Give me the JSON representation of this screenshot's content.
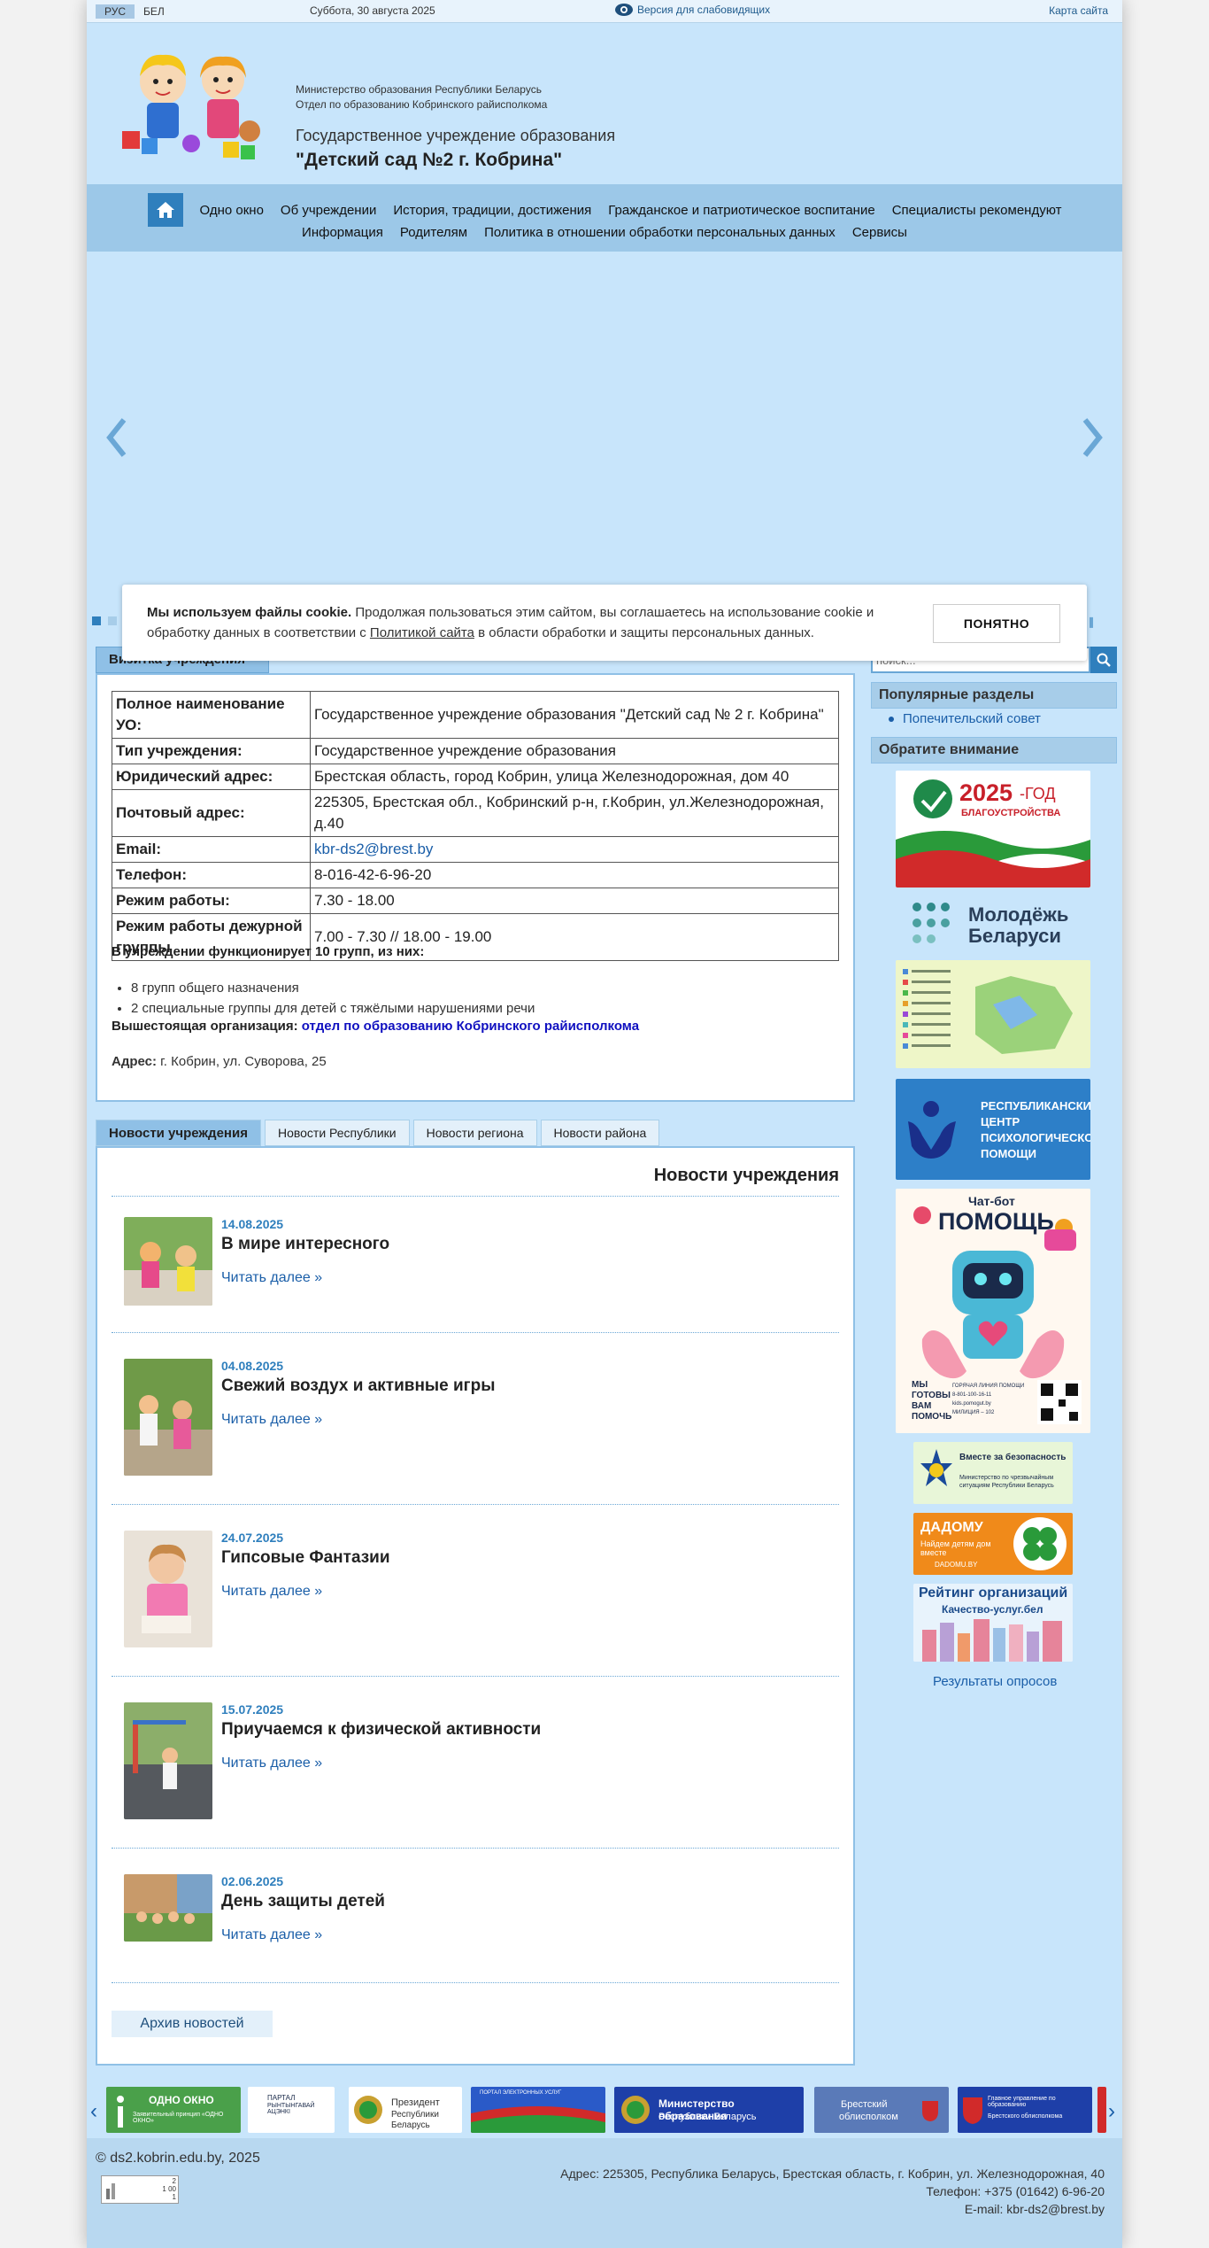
{
  "topbar": {
    "lang_ru": "РУС",
    "lang_be": "БЕЛ",
    "date": "Суббота, 30 августа 2025",
    "vision_link": "Версия для слабовидящих",
    "sitemap_link": "Карта сайта"
  },
  "header": {
    "ministry_line1": "Министерство образования Республики Беларусь",
    "ministry_line2": "Отдел по образованию Кобринского райисполкома",
    "org_type": "Государственное учреждение образования",
    "org_name": "\"Детский сад №2 г. Кобрина\""
  },
  "nav": {
    "row1": [
      "Одно окно",
      "Об учреждении",
      "История, традиции, достижения",
      "Гражданское и патриотическое воспитание",
      "Специалисты рекомендуют"
    ],
    "row2": [
      "Информация",
      "Родителям",
      "Политика в отношении обработки персональных данных",
      "Сервисы"
    ]
  },
  "cookie": {
    "bold": "Мы используем файлы cookie.",
    "text1": " Продолжая пользоваться этим сайтом, вы соглашаетесь на использование cookie и обработку данных в соответствии с ",
    "policy_link": "Политикой сайта",
    "text2": " в области обработки и защиты персональных данных.",
    "button": "ПОНЯТНО"
  },
  "vizitka": {
    "tab_label": "Визитка учреждения",
    "rows": [
      {
        "label": "Полное наименование УО:",
        "value": " Государственное учреждение образования \"Детский сад № 2 г. Кобрина\""
      },
      {
        "label": " Тип учреждения:",
        "value": " Государственное учреждение образования"
      },
      {
        "label": " Юридический адрес:",
        "value": " Брестская область, город Кобрин, улица Железнодорожная, дом 40"
      },
      {
        "label": " Почтовый адрес:",
        "value": " 225305, Брестская обл., Кобринский р-н, г.Кобрин, ул.Железнодорожная, д.40"
      },
      {
        "label": " Email:",
        "value": "kbr-ds2@brest.by"
      },
      {
        "label": " Телефон:",
        "value": " 8-016-42-6-96-20"
      },
      {
        "label": " Режим работы:",
        "value": " 7.30 - 18.00"
      },
      {
        "label": " Режим работы дежурной группы",
        "value": " 7.00 - 7.30 // 18.00 - 19.00"
      }
    ],
    "groups_title": "В учреждении функционирует 10 групп, из них:",
    "groups": [
      "8 групп общего назначения",
      "2 специальные группы для детей с  тяжёлыми нарушениями речи"
    ],
    "superior_label": "Вышестоящая организация: ",
    "superior_link": "отдел по образованию Кобринского райисполкома",
    "address_label": "Адрес:",
    "address_value": " г. Кобрин, ул. Суворова, 25"
  },
  "news": {
    "tabs": [
      "Новости учреждения",
      "Новости Республики",
      "Новости региона",
      "Новости района"
    ],
    "heading": "Новости учреждения",
    "items": [
      {
        "date": "14.08.2025",
        "title": "В мире интересного",
        "more": "Читать далее »"
      },
      {
        "date": "04.08.2025",
        "title": "Свежий воздух и активные игры",
        "more": "Читать далее »"
      },
      {
        "date": "24.07.2025",
        "title": "Гипсовые Фантазии",
        "more": "Читать далее »"
      },
      {
        "date": "15.07.2025",
        "title": "Приучаемся к физической активности",
        "more": "Читать далее »"
      },
      {
        "date": "02.06.2025",
        "title": "День защиты детей",
        "more": "Читать далее »"
      }
    ],
    "archive": "Архив новостей"
  },
  "sidebar": {
    "search_placeholder": "поиск...",
    "popular_title": "Популярные разделы",
    "popular_link": "Попечительский совет",
    "attention_title": "Обратите внимание",
    "banner1_year": "2025",
    "banner1_word": "-ГОД",
    "banner1_sub": "БЛАГОУСТРОЙСТВА",
    "banner2_line1": "Молодёжь",
    "banner2_line2": "Беларуси",
    "banner4_text": [
      "РЕСПУБЛИКАНСКИЙ",
      "ЦЕНТР",
      "ПСИХОЛОГИЧЕСКОЙ",
      "ПОМОЩИ"
    ],
    "banner5_title1": "Чат-бот",
    "banner5_title2": "ПОМОЩЬ",
    "banner5_side": [
      "МЫ",
      "ГОТОВЫ",
      "ВАМ",
      "ПОМОЧЬ"
    ],
    "banner5_info": [
      "ГОРЯЧАЯ ЛИНИЯ ПОМОЩИ",
      "8-801-100-16-11",
      "kids.pomogut.by",
      "МИЛИЦИЯ – 102"
    ],
    "banner6_line1": "Вместе за безопасность",
    "banner6_line2": "Министерство по чрезвычайным ситуациям Республики Беларусь",
    "banner7_line1": "ДАДОМУ",
    "banner7_line2": "Найдем детям дом вместе",
    "banner7_line3": "DADOMU.BY",
    "banner8_line1": "Рейтинг организаций",
    "banner8_line2": "Качество-услуг.бел",
    "survey_link": "Результаты опросов"
  },
  "partners": [
    {
      "line1": "ОДНО ОКНО",
      "line2": "Заявительный принцип «ОДНО ОКНО»"
    },
    {
      "line1": "ПАРТАЛ",
      "line2": "РЫНТЫНГАВАЙ АЦЭНКІ"
    },
    {
      "line1": "Президент",
      "line2": "Республики Беларусь"
    },
    {
      "line1": "ПОРТАЛ ЭЛЕКТРОННЫХ УСЛУГ",
      "line2": ""
    },
    {
      "line1": "Министерство образования",
      "line2": "Республики Беларусь"
    },
    {
      "line1": "Брестский",
      "line2": "облисполком"
    },
    {
      "line1": "Главное управление по образованию",
      "line2": "Брестского облисполкома"
    }
  ],
  "footer": {
    "copyright": "© ds2.kobrin.edu.by, 2025",
    "address": "Адрес: 225305, Республика Беларусь, Брестская область, г. Кобрин, ул. Железнодорожная, 40",
    "phone": "Телефон: +375 (01642) 6-96-20",
    "email": "E-mail: kbr-ds2@brest.by",
    "counter_values": [
      "2",
      "1 00",
      "1"
    ]
  },
  "colors": {
    "page_bg": "#c8e5fb",
    "nav_bg": "#9cc8e8",
    "accent": "#2f7fbd",
    "link": "#1a5ea8"
  }
}
